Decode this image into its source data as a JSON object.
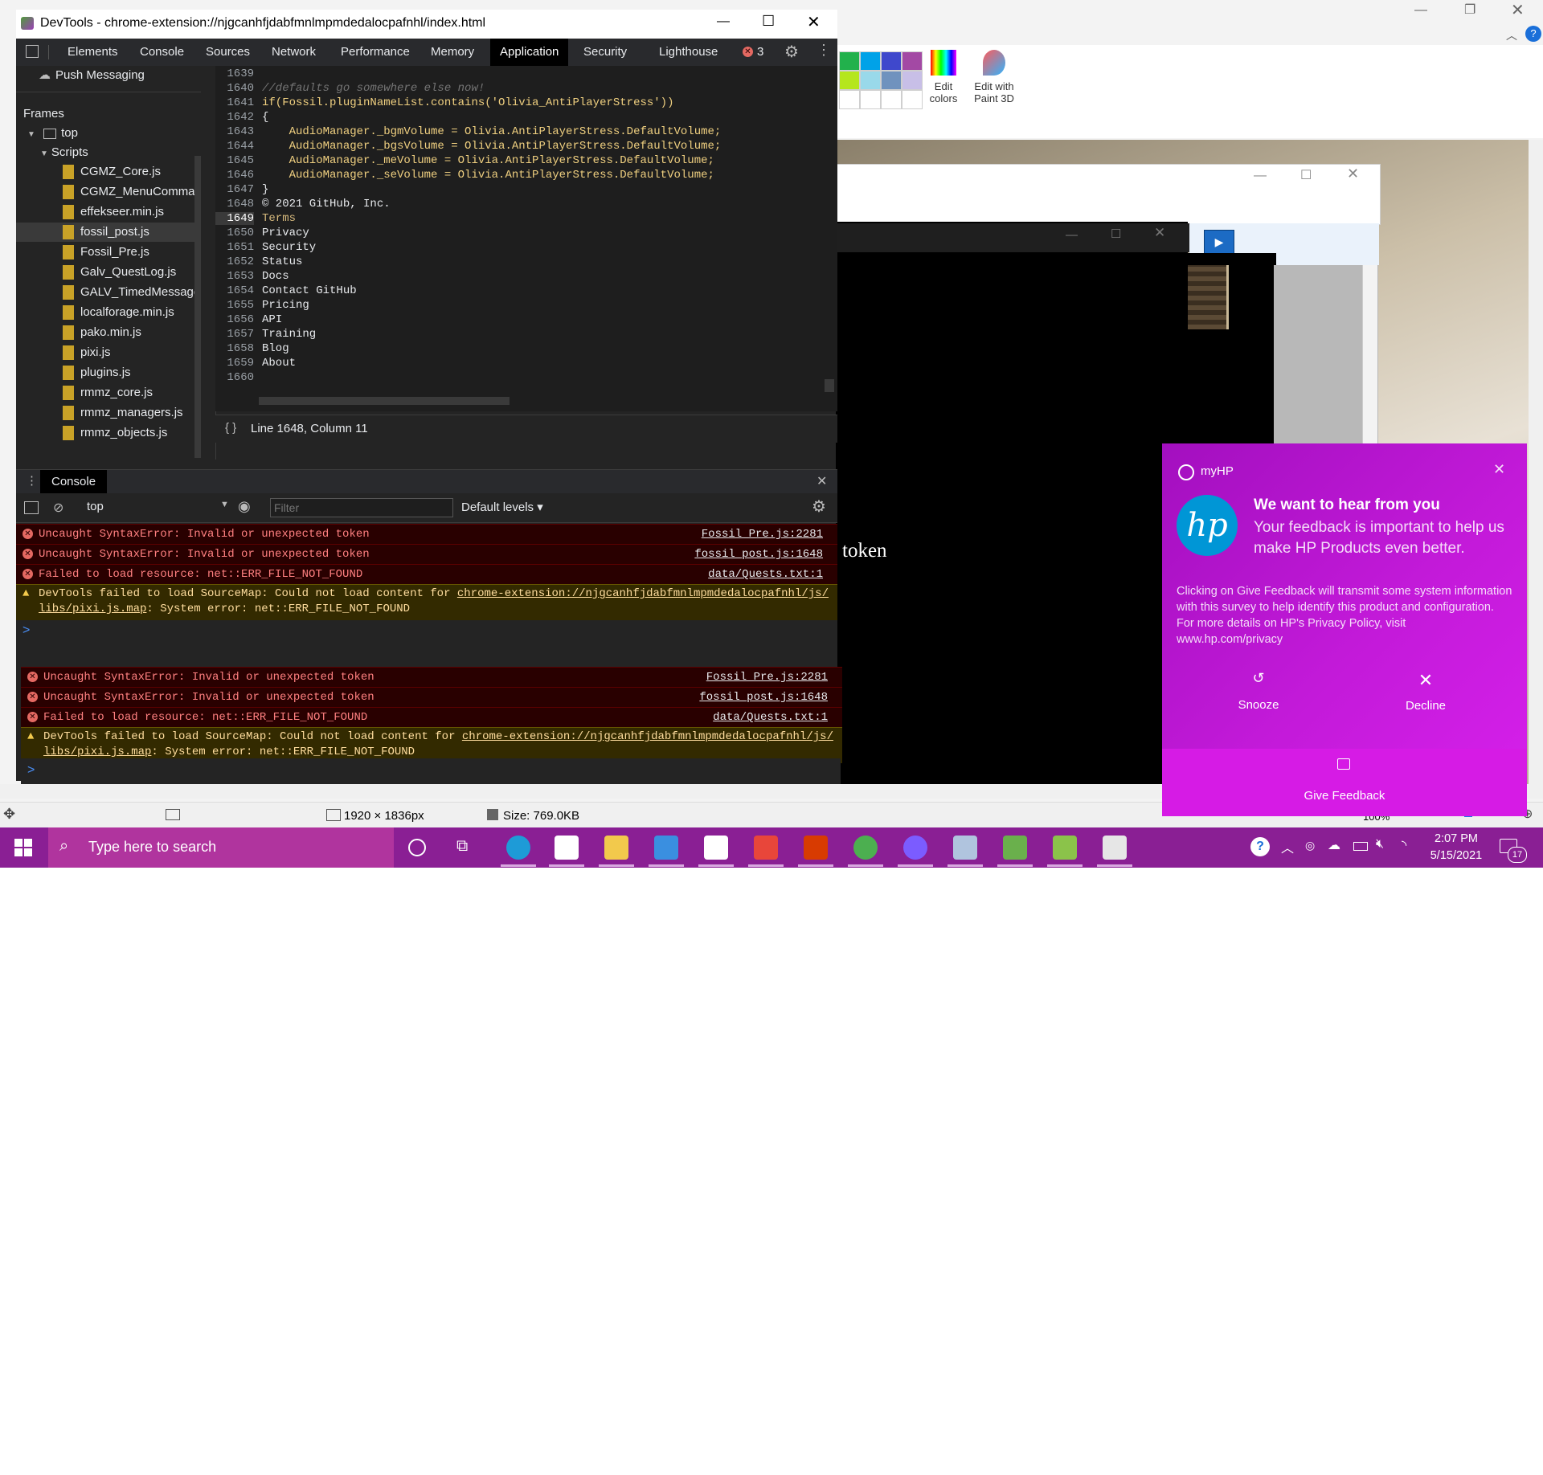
{
  "devtools": {
    "title": "DevTools - chrome-extension://njgcanhfjdabfmnlmpmdedalocpafnhl/index.html",
    "tabs": [
      "Elements",
      "Console",
      "Sources",
      "Network",
      "Performance",
      "Memory",
      "Application",
      "Security",
      "Lighthouse"
    ],
    "active_tab": "Application",
    "error_count": "3",
    "sidebar": {
      "push_messaging": "Push Messaging",
      "frames_heading": "Frames",
      "top": "top",
      "scripts": "Scripts",
      "files": [
        "CGMZ_Core.js",
        "CGMZ_MenuCommand",
        "effekseer.min.js",
        "fossil_post.js",
        "Fossil_Pre.js",
        "Galv_QuestLog.js",
        "GALV_TimedMessageP",
        "localforage.min.js",
        "pako.min.js",
        "pixi.js",
        "plugins.js",
        "rmmz_core.js",
        "rmmz_managers.js",
        "rmmz_objects.js"
      ],
      "selected_file": "fossil_post.js"
    },
    "editor": {
      "lines": [
        {
          "n": "1639",
          "t": ""
        },
        {
          "n": "1640",
          "t": "//defaults go somewhere else now!"
        },
        {
          "n": "1641",
          "t": "if(Fossil.pluginNameList.contains('Olivia_AntiPlayerStress'))"
        },
        {
          "n": "1642",
          "t": "{"
        },
        {
          "n": "1643",
          "t": "    AudioManager._bgmVolume = Olivia.AntiPlayerStress.DefaultVolume;"
        },
        {
          "n": "1644",
          "t": "    AudioManager._bgsVolume = Olivia.AntiPlayerStress.DefaultVolume;"
        },
        {
          "n": "1645",
          "t": "    AudioManager._meVolume = Olivia.AntiPlayerStress.DefaultVolume;"
        },
        {
          "n": "1646",
          "t": "    AudioManager._seVolume = Olivia.AntiPlayerStress.DefaultVolume;"
        },
        {
          "n": "1647",
          "t": "}"
        },
        {
          "n": "1648",
          "t": "© 2021 GitHub, Inc."
        },
        {
          "n": "1649",
          "t": "Terms"
        },
        {
          "n": "1650",
          "t": "Privacy"
        },
        {
          "n": "1651",
          "t": "Security"
        },
        {
          "n": "1652",
          "t": "Status"
        },
        {
          "n": "1653",
          "t": "Docs"
        },
        {
          "n": "1654",
          "t": "Contact GitHub"
        },
        {
          "n": "1655",
          "t": "Pricing"
        },
        {
          "n": "1656",
          "t": "API"
        },
        {
          "n": "1657",
          "t": "Training"
        },
        {
          "n": "1658",
          "t": "Blog"
        },
        {
          "n": "1659",
          "t": "About"
        },
        {
          "n": "1660",
          "t": ""
        }
      ],
      "status": "Line 1648, Column 11",
      "format_icon": "{ }"
    },
    "console": {
      "tab_label": "Console",
      "context": "top",
      "filter_placeholder": "Filter",
      "levels": "Default levels ▾",
      "messages": [
        {
          "type": "error",
          "text": "Uncaught SyntaxError: Invalid or unexpected token",
          "src": "Fossil_Pre.js:2281"
        },
        {
          "type": "error",
          "text": "Uncaught SyntaxError: Invalid or unexpected token",
          "src": "fossil_post.js:1648"
        },
        {
          "type": "error",
          "text": "Failed to load resource: net::ERR_FILE_NOT_FOUND",
          "src": "data/Quests.txt:1"
        }
      ],
      "warning": {
        "line1": "DevTools failed to load SourceMap: Could not load content for ",
        "link1": "chrome-extension://njgcanhfjdabfmnlmpmdedalocpafnhl/js/",
        "link2": "libs/pixi.js.map",
        "line2": ": System error: net::ERR_FILE_NOT_FOUND"
      },
      "prompt": ">"
    }
  },
  "paint": {
    "edit_colors": "Edit colors",
    "edit_with_paint3d": "Edit with Paint 3D",
    "dimensions": "1920 × 1836px",
    "size": "Size: 769.0KB",
    "zoom": "100%",
    "swatch_colors": [
      "#22b14c",
      "#00a2e8",
      "#3f48cc",
      "#a349a4",
      "#b5e61d",
      "#99d9ea",
      "#7092be",
      "#c8bfe7"
    ]
  },
  "game": {
    "token_text": "token"
  },
  "toast": {
    "app": "myHP",
    "heading": "We want to hear from you",
    "subheading": "Your feedback is important to help us make HP Products even better.",
    "body": "Clicking on Give Feedback will transmit some system information with this survey to help identify this product and configuration. For more details on HP's Privacy Policy, visit www.hp.com/privacy",
    "snooze": "Snooze",
    "decline": "Decline",
    "give_feedback": "Give Feedback",
    "logo_text": "hp"
  },
  "taskbar": {
    "search_placeholder": "Type here to search",
    "time": "2:07 PM",
    "date": "5/15/2021",
    "notification_count": "17"
  }
}
